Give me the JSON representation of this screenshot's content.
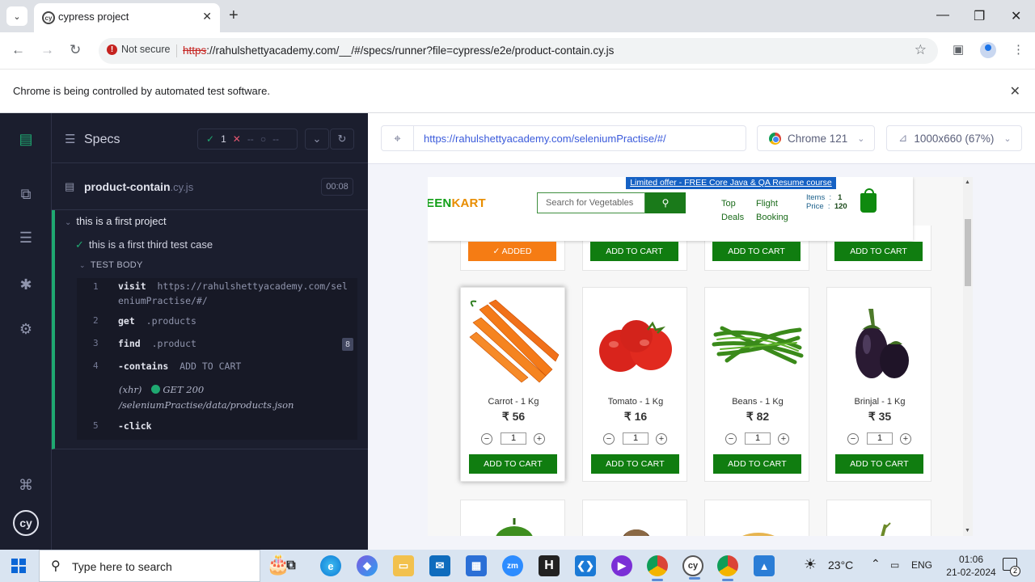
{
  "browser": {
    "tab_title": "cypress project",
    "address": {
      "security_label": "Not secure",
      "url_scheme": "https",
      "url_rest": "://rahulshettyacademy.com/__/#/specs/runner?file=cypress/e2e/product-contain.cy.js"
    },
    "automation_banner": "Chrome is being controlled by automated test software."
  },
  "cypress": {
    "specs_label": "Specs",
    "stats": {
      "passed": "1",
      "failed": "--",
      "pending": "--"
    },
    "spec": {
      "name": "product-contain",
      "ext": ".cy.js",
      "duration": "00:08"
    },
    "suite_title": "this is a first project",
    "test_title": "this is a first third test case",
    "test_body_label": "TEST BODY",
    "commands": [
      {
        "num": "1",
        "name": "visit",
        "message_line1": "https://rahulshettyacademy.com/sel",
        "message_line2": "eniumPractise/#/"
      },
      {
        "num": "2",
        "name": "get",
        "message": ".products"
      },
      {
        "num": "3",
        "name": "find",
        "message": ".product",
        "badge": "8"
      },
      {
        "num": "4",
        "name": "-contains",
        "message": "ADD TO CART"
      },
      {
        "xhr_label": "(xhr)",
        "xhr_line1": "GET 200",
        "xhr_line2": "/seleniumPractise/data/products.json"
      },
      {
        "num": "5",
        "name": "-click"
      }
    ],
    "aut": {
      "url": "https://rahulshettyacademy.com/seleniumPractise/#/",
      "browser": "Chrome 121",
      "viewport": "1000x660 (67%)"
    }
  },
  "greenkart": {
    "promo": "Limited offer - FREE Core Java & QA Resume course",
    "logo_green": "EEN",
    "logo_orange": "KART",
    "search_placeholder": "Search for Vegetables",
    "top_deals_l1": "Top",
    "top_deals_l2": "Deals",
    "flight_l1": "Flight",
    "flight_l2": "Booking",
    "items_label": "Items",
    "items_value": "1",
    "price_label": "Price",
    "price_value": "120",
    "top_row_buttons": [
      "✓ ADDED",
      "ADD TO CART",
      "ADD TO CART",
      "ADD TO CART"
    ],
    "products": [
      {
        "name": "Carrot - 1 Kg",
        "price": "₹ 56",
        "qty": "1",
        "button": "ADD TO CART",
        "image": "carrot-image"
      },
      {
        "name": "Tomato - 1 Kg",
        "price": "₹ 16",
        "qty": "1",
        "button": "ADD TO CART",
        "image": "tomato-image"
      },
      {
        "name": "Beans - 1 Kg",
        "price": "₹ 82",
        "qty": "1",
        "button": "ADD TO CART",
        "image": "beans-image"
      },
      {
        "name": "Brinjal - 1 Kg",
        "price": "₹ 35",
        "qty": "1",
        "button": "ADD TO CART",
        "image": "brinjal-image"
      }
    ]
  },
  "taskbar": {
    "search_placeholder": "Type here to search",
    "weather": "23°C",
    "language": "ENG",
    "time": "01:06",
    "date": "21-02-2024",
    "notification_count": "2"
  },
  "colors": {
    "cypress_bg": "#1b1e2e",
    "pass_green": "#1fa971",
    "greenkart_green": "#107d10",
    "added_orange": "#f57c14"
  }
}
